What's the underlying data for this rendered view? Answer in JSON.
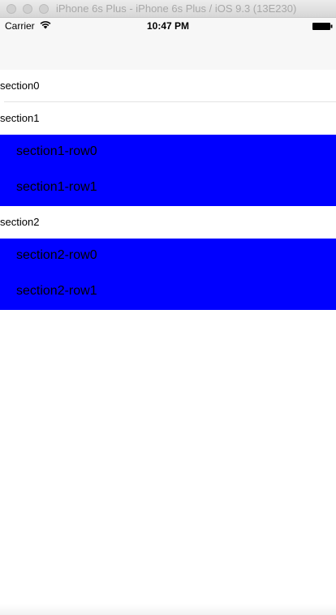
{
  "window": {
    "title": "iPhone 6s Plus - iPhone 6s Plus / iOS 9.3 (13E230)"
  },
  "status_bar": {
    "carrier": "Carrier",
    "time": "10:47 PM",
    "wifi_icon": "wifi-icon",
    "battery_icon": "battery-icon"
  },
  "colors": {
    "row_background": "#0000ff",
    "section_background": "#ffffff"
  },
  "table": {
    "sections": [
      {
        "header": "section0",
        "rows": []
      },
      {
        "header": "section1",
        "rows": [
          "section1-row0",
          "section1-row1"
        ]
      },
      {
        "header": "section2",
        "rows": [
          "section2-row0",
          "section2-row1"
        ]
      }
    ]
  }
}
